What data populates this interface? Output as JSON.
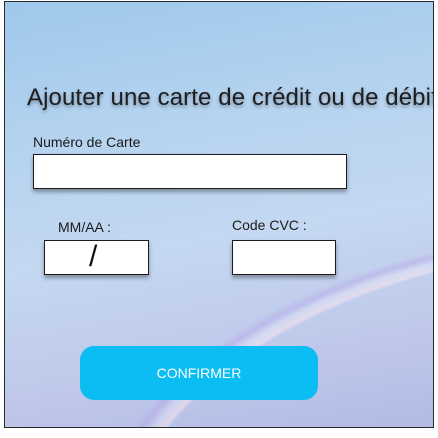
{
  "title": "Ajouter une carte de crédit ou de débit",
  "card_number": {
    "label": "Numéro de Carte",
    "value": ""
  },
  "expiry": {
    "label": "MM/AA :",
    "separator": "/",
    "value": ""
  },
  "cvc": {
    "label": "Code CVC :",
    "value": ""
  },
  "confirm_button": {
    "label": "CONFIRMER"
  },
  "colors": {
    "accent": "#0bbdf2",
    "background_top": "#9ec8ec",
    "background_bottom": "#b2bbe4"
  }
}
